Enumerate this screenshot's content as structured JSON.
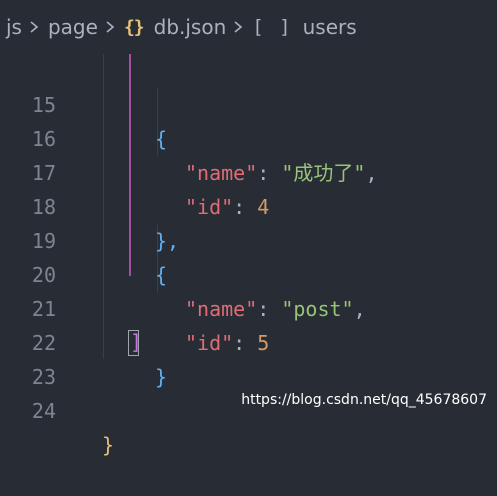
{
  "breadcrumb": {
    "items": [
      "js",
      "page",
      "db.json",
      "users"
    ],
    "icons": [
      "chevron-right-icon",
      "chevron-right-icon",
      "json-braces-icon",
      "chevron-right-icon",
      "array-brackets-icon"
    ],
    "json_icon_glyph": "{}",
    "array_icon_glyph": "[ ]"
  },
  "editor": {
    "lines": [
      {
        "number": "15"
      },
      {
        "number": "16"
      },
      {
        "number": "17"
      },
      {
        "number": "18"
      },
      {
        "number": "19"
      },
      {
        "number": "20"
      },
      {
        "number": "21"
      },
      {
        "number": "22"
      },
      {
        "number": "23"
      },
      {
        "number": "24"
      }
    ],
    "tokens": {
      "open_brace": "{",
      "close_brace": "}",
      "close_brace_comma": "},",
      "close_bracket": "]",
      "name_key": "\"name\"",
      "id_key": "\"id\"",
      "colon": ":",
      "comma": ",",
      "value_1_name": "\"成功了\"",
      "value_1_id": "4",
      "value_2_name": "\"post\"",
      "value_2_id": "5"
    }
  },
  "watermark": "https://blog.csdn.net/qq_45678607",
  "colors": {
    "background": "#282c34",
    "line_number": "#7f848e",
    "key": "#e06c75",
    "string": "#98c379",
    "number": "#d19a66",
    "brace_blue": "#61afef",
    "brace_yellow": "#e5c07b",
    "active_guide": "#a84e9e"
  }
}
